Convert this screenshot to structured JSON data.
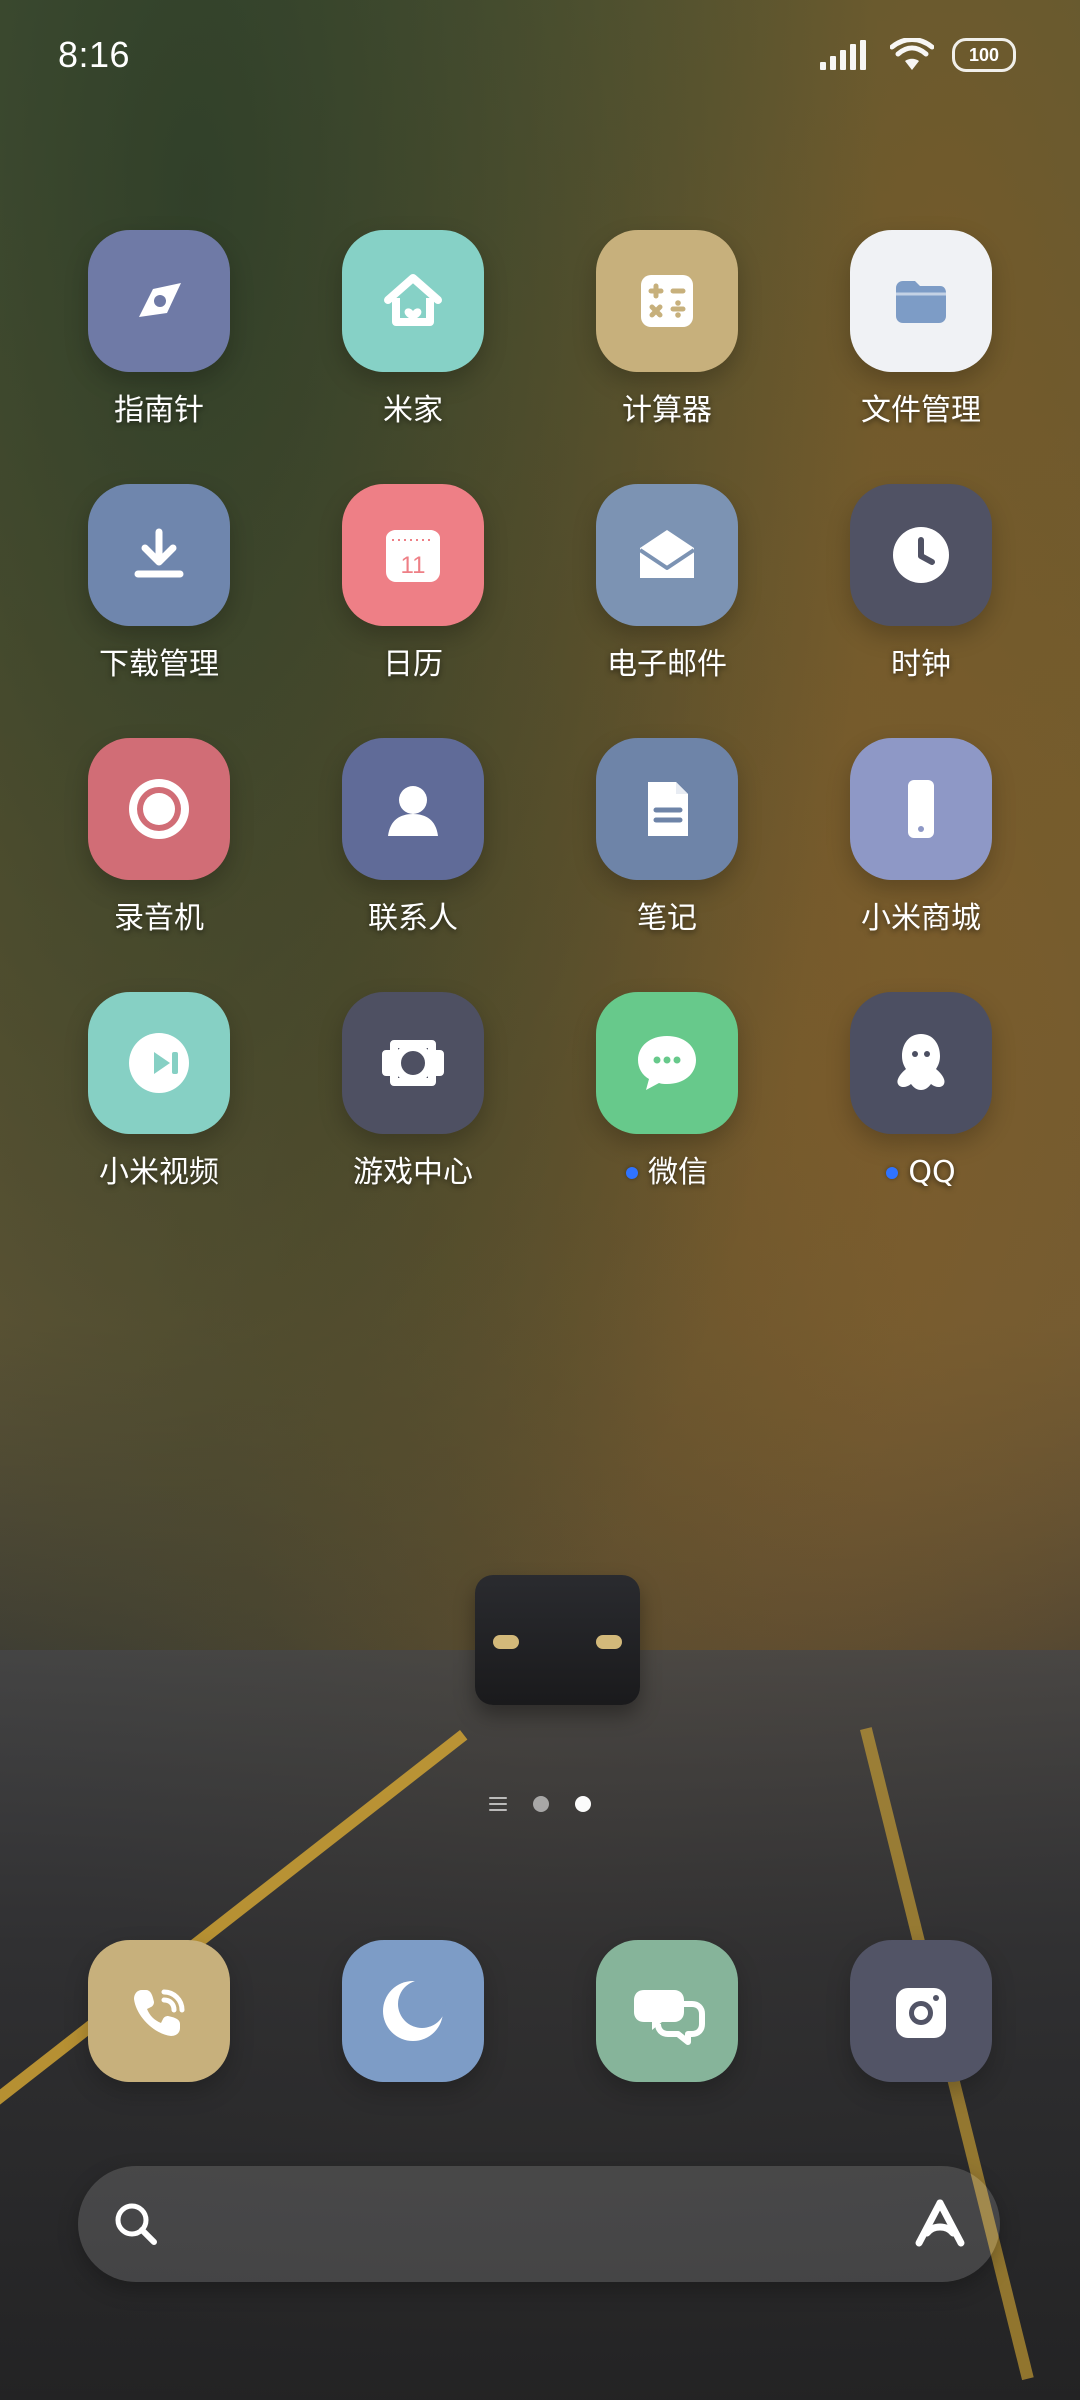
{
  "status_bar": {
    "time": "8:16",
    "battery": "100"
  },
  "colors": {
    "badge_dot": "#2f73ff",
    "compass": "#6f7aa6",
    "mijia": "#86d1c6",
    "calculator": "#c7b07c",
    "files": "#f0f2f5",
    "downloads": "#6f86ad",
    "calendar": "#ee7f86",
    "email": "#7c93b3",
    "clock": "#505264",
    "recorder": "#d16d76",
    "contacts": "#606b98",
    "notes": "#6e84a8",
    "mi_store": "#8e98c6",
    "mi_video": "#86d0c4",
    "game_center": "#4e5062",
    "wechat": "#67c98b",
    "qq": "#4c4f62",
    "dock_phone": "#c7b07c",
    "dock_browser": "#7d9cc6",
    "dock_messages": "#86b49a",
    "dock_camera": "#525466"
  },
  "apps": [
    {
      "label": "指南针",
      "icon": "compass-icon",
      "badge": false
    },
    {
      "label": "米家",
      "icon": "home-icon",
      "badge": false
    },
    {
      "label": "计算器",
      "icon": "calculator-icon",
      "badge": false
    },
    {
      "label": "文件管理",
      "icon": "folder-icon",
      "badge": false
    },
    {
      "label": "下载管理",
      "icon": "download-icon",
      "badge": false
    },
    {
      "label": "日历",
      "icon": "calendar-icon",
      "badge": false,
      "calendar_day": "11"
    },
    {
      "label": "电子邮件",
      "icon": "envelope-icon",
      "badge": false
    },
    {
      "label": "时钟",
      "icon": "clock-icon",
      "badge": false
    },
    {
      "label": "录音机",
      "icon": "record-icon",
      "badge": false
    },
    {
      "label": "联系人",
      "icon": "person-icon",
      "badge": false
    },
    {
      "label": "笔记",
      "icon": "note-icon",
      "badge": false
    },
    {
      "label": "小米商城",
      "icon": "phone-icon",
      "badge": false
    },
    {
      "label": "小米视频",
      "icon": "video-play-icon",
      "badge": false
    },
    {
      "label": "游戏中心",
      "icon": "game-controller-icon",
      "badge": false
    },
    {
      "label": "微信",
      "icon": "chat-bubble-icon",
      "badge": true
    },
    {
      "label": "QQ",
      "icon": "penguin-icon",
      "badge": true
    }
  ],
  "dock": [
    {
      "icon": "phone-call-icon"
    },
    {
      "icon": "browser-moon-icon"
    },
    {
      "icon": "messages-icon"
    },
    {
      "icon": "camera-icon"
    }
  ],
  "pager": {
    "pages": 2,
    "active_index": 1
  },
  "search": {
    "left_icon": "search-icon",
    "right_icon": "xiaoai-assistant-icon"
  }
}
